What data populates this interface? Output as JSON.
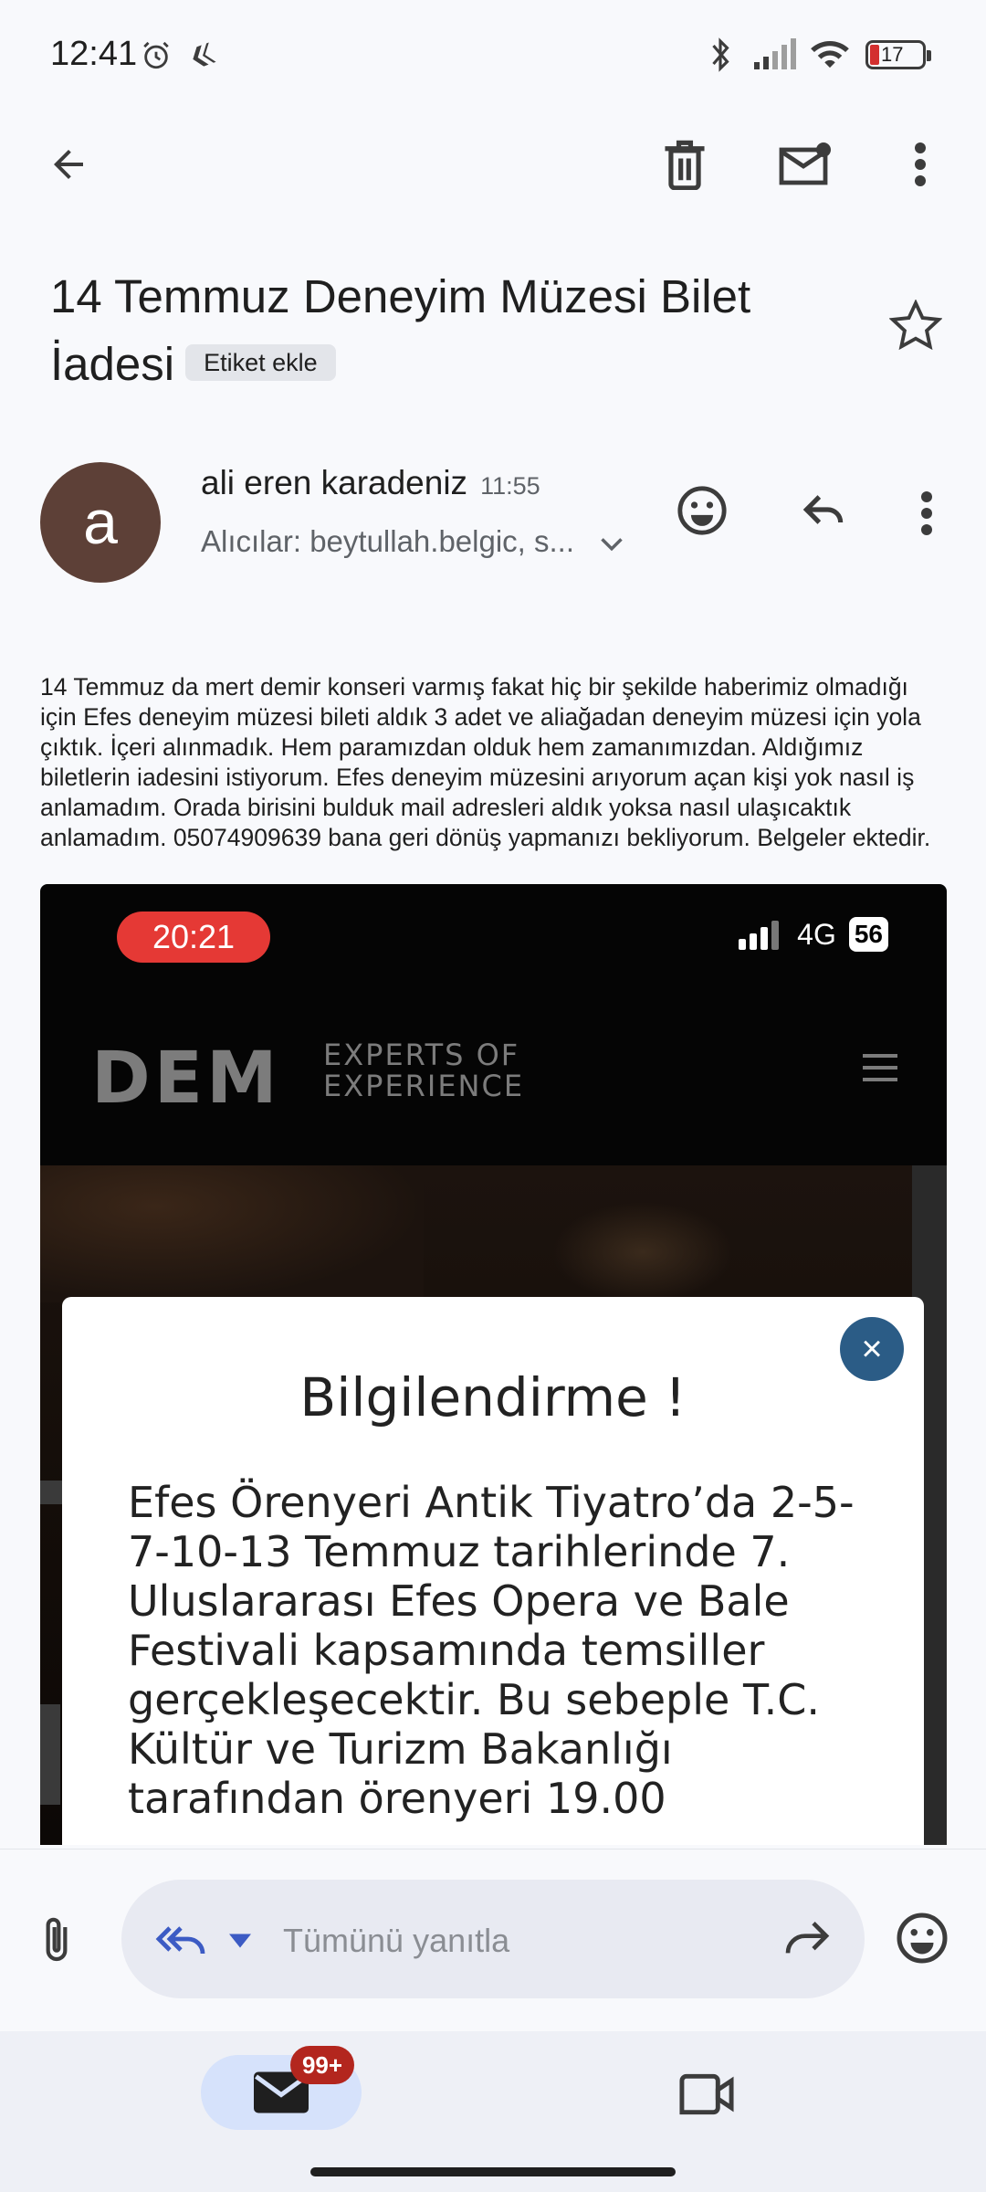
{
  "status_bar": {
    "time": "12:41",
    "battery": "17",
    "icons": [
      "alarm-icon",
      "app-notification-icon",
      "bluetooth-icon",
      "signal-icon",
      "wifi-icon",
      "battery-icon"
    ]
  },
  "toolbar": {
    "icons": [
      "back-arrow-icon",
      "delete-icon",
      "mark-unread-icon",
      "more-vert-icon"
    ]
  },
  "email": {
    "subject": "14 Temmuz Deneyim Müzesi Bilet İadesi",
    "label_chip": "Etiket ekle",
    "sender": {
      "avatar_letter": "a",
      "avatar_color": "#5d4037",
      "name": "ali eren karadeniz",
      "time": "11:55",
      "recipients": "Alıcılar: beytullah.belgic, s..."
    },
    "body": "14 Temmuz da mert demir konseri varmış fakat hiç bir şekilde haberimiz olmadığı için Efes deneyim müzesi bileti aldık 3 adet ve aliağadan deneyim müzesi için yola çıktık. İçeri alınmadık. Hem paramızdan olduk hem zamanımızdan. Aldığımız biletlerin iadesini istiyorum. Efes deneyim müzesini arıyorum açan kişi yok nasıl iş anlamadım. Orada birisini bulduk mail adresleri aldık yoksa nasıl ulaşıcaktık anlamadım. 05074909639 bana geri dönüş yapmanızı bekliyorum. Belgeler ektedir."
  },
  "attachment_image": {
    "phone_time": "20:21",
    "network": "4G",
    "battery": "56",
    "logo": "DEM",
    "logo_sub_1": "EXPERTS OF",
    "logo_sub_2": "EXPERIENCE",
    "modal_title": "Bilgilendirme !",
    "modal_body": "Efes Örenyeri  Antik Tiyatro’da 2-5-7-10-13  Temmuz tarihlerinde  7.  Uluslararası Efes  Opera  ve  Bale  Festivali kapsamında temsiller gerçekleşecektir. Bu sebeple T.C. Kültür ve Turizm Bakanlığı tarafından örenyeri 19.00"
  },
  "reply_bar": {
    "placeholder": "Tümünü yanıtla"
  },
  "bottom_nav": {
    "mail_badge": "99+"
  },
  "colors": {
    "accent_blue": "#3c5bc4",
    "badge_red": "#b3261e",
    "nav_pill": "#d6e2fb"
  }
}
